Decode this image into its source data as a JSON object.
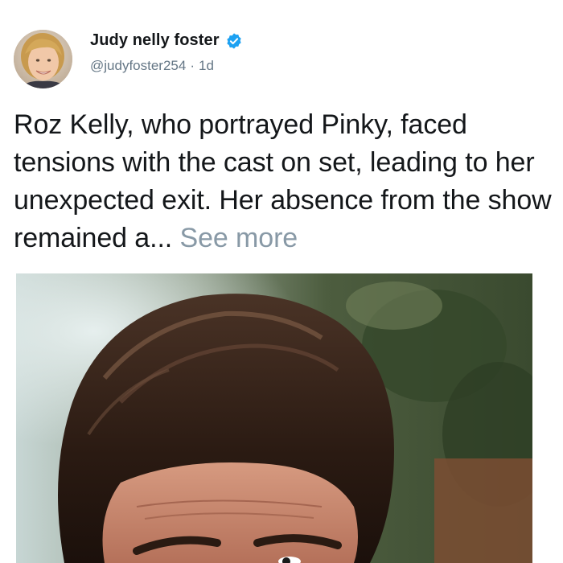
{
  "author": {
    "name": "Judy nelly foster",
    "handle": "@judyfoster254",
    "separator": "·",
    "time": "1d",
    "verified": true
  },
  "post": {
    "text": "Roz Kelly, who portrayed Pinky, faced tensions with the cast on set, leading to her unexpected exit. Her absence from the show remained a...",
    "see_more_label": "See more"
  },
  "colors": {
    "verified_badge": "#1da1f2",
    "text": "#14171a",
    "muted": "#657786",
    "see_more": "#8899a6"
  },
  "icons": {
    "verified": "verified-badge-icon",
    "avatar": "profile-photo"
  }
}
